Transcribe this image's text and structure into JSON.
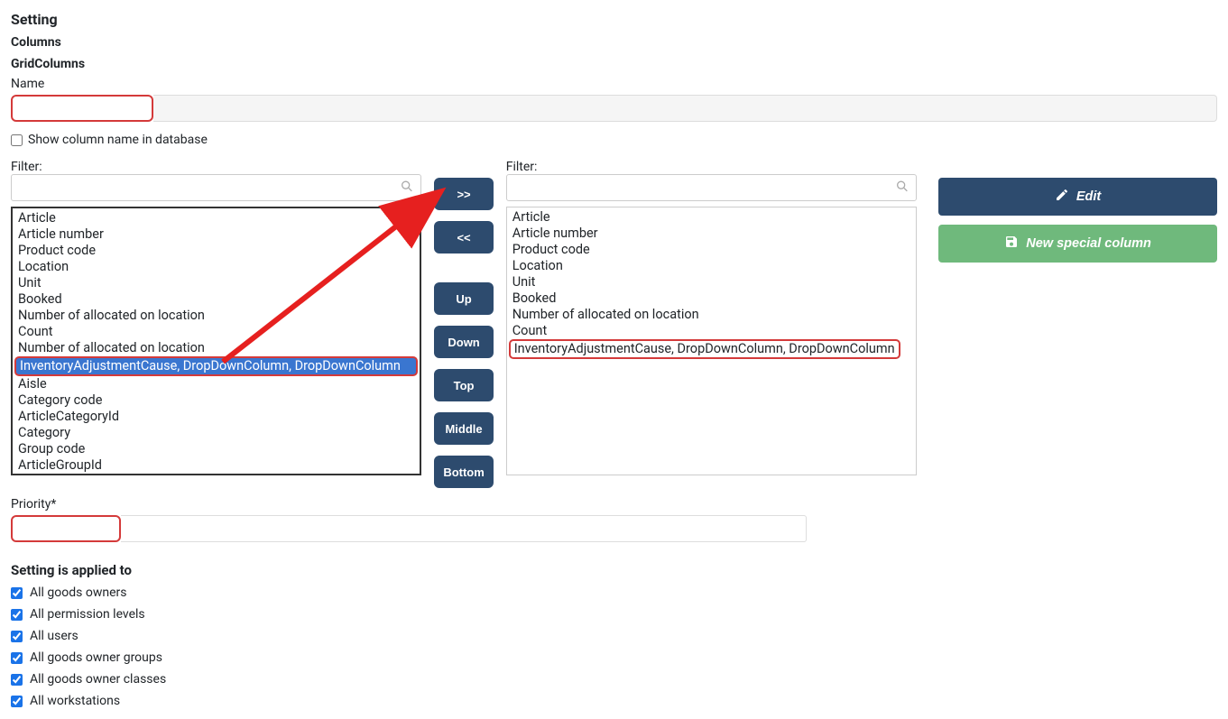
{
  "heading": "Setting",
  "subheadings": {
    "columns": "Columns",
    "gridcolumns": "GridColumns"
  },
  "name_label": "Name",
  "show_db_name": {
    "label": "Show column name in database",
    "checked": false
  },
  "filter_label_left": "Filter:",
  "filter_label_right": "Filter:",
  "left_list": [
    "Article",
    "Article number",
    "Product code",
    "Location",
    "Unit",
    "Booked",
    "Number of allocated on location",
    "Count",
    "Number of allocated on location",
    "InventoryAdjustmentCause, DropDownColumn, DropDownColumn",
    "Aisle",
    "Category code",
    "ArticleCategoryId",
    "Category",
    "Group code",
    "ArticleGroupId"
  ],
  "left_selected_index": 9,
  "right_list": [
    "Article",
    "Article number",
    "Product code",
    "Location",
    "Unit",
    "Booked",
    "Number of allocated on location",
    "Count",
    "InventoryAdjustmentCause, DropDownColumn, DropDownColumn"
  ],
  "right_highlight_index": 8,
  "buttons": {
    "move_right": ">>",
    "move_left": "<<",
    "up": "Up",
    "down": "Down",
    "top": "Top",
    "middle": "Middle",
    "bottom": "Bottom"
  },
  "actions": {
    "edit": "Edit",
    "new_special": "New special column"
  },
  "priority_label": "Priority*",
  "applied_heading": "Setting is applied to",
  "applied_items": [
    {
      "label": "All goods owners",
      "checked": true
    },
    {
      "label": "All permission levels",
      "checked": true
    },
    {
      "label": "All users",
      "checked": true
    },
    {
      "label": "All goods owner groups",
      "checked": true
    },
    {
      "label": "All goods owner classes",
      "checked": true
    },
    {
      "label": "All workstations",
      "checked": true
    }
  ]
}
